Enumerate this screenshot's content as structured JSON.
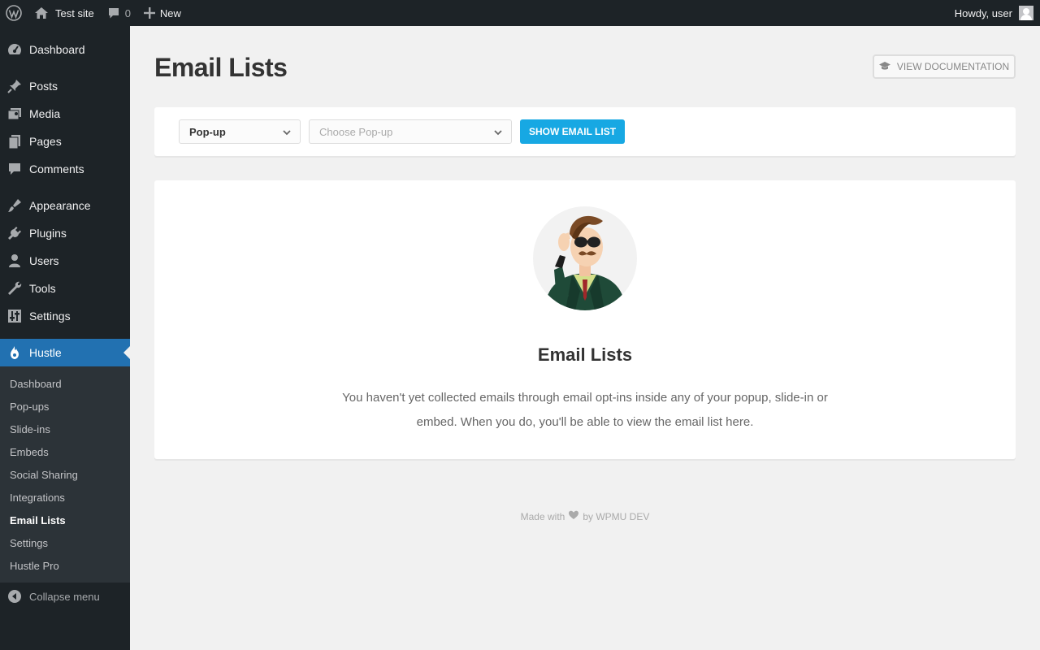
{
  "adminbar": {
    "site_name": "Test site",
    "comments_count": "0",
    "new_label": "New",
    "greeting": "Howdy, user"
  },
  "sidebar": {
    "items": [
      {
        "label": "Dashboard",
        "icon": "dashboard-icon"
      },
      {
        "label": "Posts",
        "icon": "pin-icon"
      },
      {
        "label": "Media",
        "icon": "media-icon"
      },
      {
        "label": "Pages",
        "icon": "pages-icon"
      },
      {
        "label": "Comments",
        "icon": "comment-icon"
      },
      {
        "label": "Appearance",
        "icon": "brush-icon"
      },
      {
        "label": "Plugins",
        "icon": "plug-icon"
      },
      {
        "label": "Users",
        "icon": "user-icon"
      },
      {
        "label": "Tools",
        "icon": "wrench-icon"
      },
      {
        "label": "Settings",
        "icon": "settings-icon"
      },
      {
        "label": "Hustle",
        "icon": "hustle-icon"
      }
    ],
    "submenu": [
      "Dashboard",
      "Pop-ups",
      "Slide-ins",
      "Embeds",
      "Social Sharing",
      "Integrations",
      "Email Lists",
      "Settings",
      "Hustle Pro"
    ],
    "collapse_label": "Collapse menu"
  },
  "main": {
    "title": "Email Lists",
    "doc_button": "View Documentation",
    "filter": {
      "type_value": "Pop-up",
      "popup_placeholder": "Choose Pop-up",
      "show_button": "Show Email List"
    },
    "empty": {
      "title": "Email Lists",
      "text": "You haven't yet collected emails through email opt-ins inside any of your popup, slide-in or embed. When you do, you'll be able to view the email list here."
    },
    "footer": {
      "made_with": "Made with",
      "by": "by WPMU DEV"
    }
  },
  "colors": {
    "adminbar_bg": "#1d2327",
    "accent_active": "#2271b1",
    "button_blue": "#17a8e3"
  }
}
